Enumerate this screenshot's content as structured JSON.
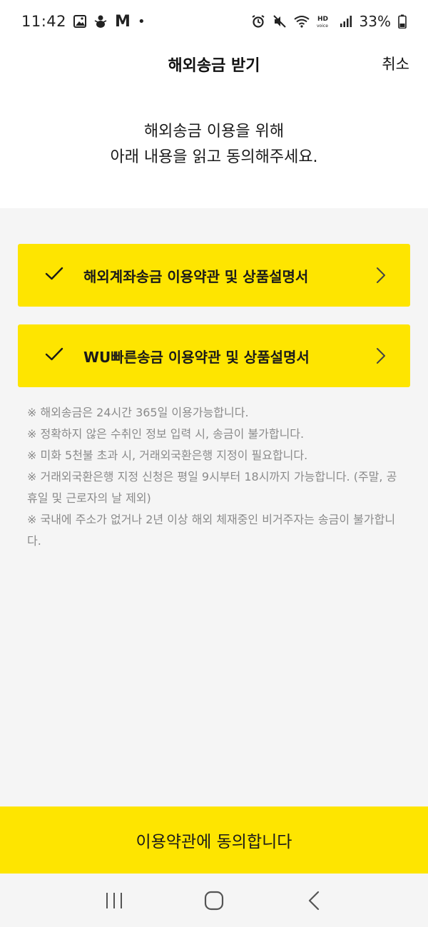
{
  "status_bar": {
    "time": "11:42",
    "mail_letter": "M",
    "dot": "•",
    "battery": "33%"
  },
  "header": {
    "title": "해외송금 받기",
    "cancel": "취소"
  },
  "intro": {
    "line1": "해외송금 이용을 위해",
    "line2": "아래 내용을 읽고 동의해주세요."
  },
  "terms": [
    {
      "label": "해외계좌송금 이용약관 및 상품설명서",
      "checked": true
    },
    {
      "label": "WU빠른송금 이용약관 및 상품설명서",
      "checked": true
    }
  ],
  "notes": [
    "※ 해외송금은 24시간 365일 이용가능합니다.",
    "※ 정확하지 않은 수취인 정보 입력 시, 송금이 불가합니다.",
    "※ 미화 5천불 초과 시, 거래외국환은행 지정이 필요합니다.",
    "※ 거래외국환은행 지정 신청은 평일 9시부터 18시까지 가능합니다. (주말, 공휴일 및 근로자의 날 제외)",
    "※ 국내에 주소가 없거나 2년 이상 해외 체재중인 비거주자는 송금이 불가합니다."
  ],
  "agree_button": "이용약관에 동의합니다",
  "colors": {
    "accent": "#fee500",
    "background": "#f5f5f5",
    "note_text": "#8a8a8a"
  }
}
